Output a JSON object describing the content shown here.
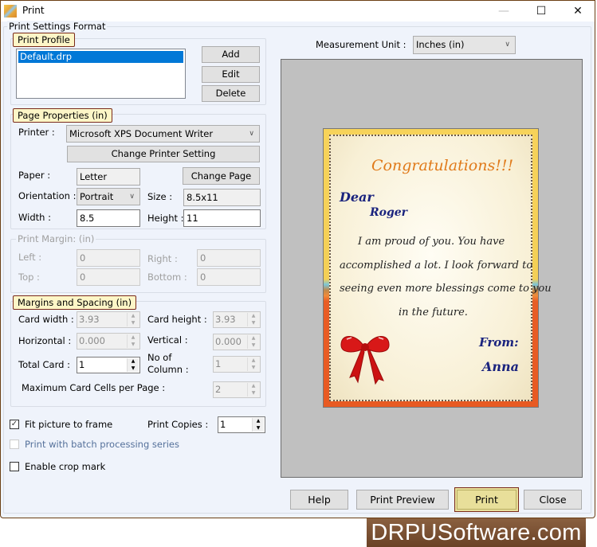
{
  "window": {
    "title": "Print",
    "icon": "print-app-icon",
    "controls": {
      "minimize": "—",
      "maximize": "☐",
      "close": "✕"
    }
  },
  "settings_group": {
    "label": "Print Settings Format"
  },
  "print_profile": {
    "label": "Print Profile",
    "items": [
      "Default.drp"
    ],
    "selected": "Default.drp",
    "buttons": {
      "add": "Add",
      "edit": "Edit",
      "delete": "Delete"
    }
  },
  "page_properties": {
    "label": "Page Properties  (in)",
    "printer_label": "Printer :",
    "printer_value": "Microsoft XPS Document Writer",
    "change_printer_button": "Change Printer Setting",
    "paper_label": "Paper :",
    "paper_value": "Letter",
    "change_page_button": "Change Page",
    "orientation_label": "Orientation :",
    "orientation_value": "Portrait",
    "size_label": "Size :",
    "size_value": "8.5x11",
    "width_label": "Width :",
    "width_value": "8.5",
    "height_label": "Height :",
    "height_value": "11"
  },
  "print_margins": {
    "label": "Print Margin: (in)",
    "left_label": "Left :",
    "left_value": "0",
    "right_label": "Right :",
    "right_value": "0",
    "top_label": "Top :",
    "top_value": "0",
    "bottom_label": "Bottom :",
    "bottom_value": "0"
  },
  "margins_spacing": {
    "label": "Margins and Spacing  (in)",
    "card_width_label": "Card width :",
    "card_width_value": "3.93",
    "card_height_label": "Card height :",
    "card_height_value": "3.93",
    "horizontal_label": "Horizontal :",
    "horizontal_value": "0.000",
    "vertical_label": "Vertical :",
    "vertical_value": "0.000",
    "total_card_label": "Total Card :",
    "total_card_value": "1",
    "no_of_column_label_1": "No of",
    "no_of_column_label_2": "Column :",
    "no_of_column_value": "1",
    "max_cells_label": "Maximum Card Cells per Page :",
    "max_cells_value": "2"
  },
  "options": {
    "fit_picture_label": "Fit picture to frame",
    "fit_picture_checked": true,
    "batch_label": "Print with batch processing series",
    "batch_checked": false,
    "crop_mark_label": "Enable crop mark",
    "crop_mark_checked": false,
    "print_copies_label": "Print Copies :",
    "print_copies_value": "1"
  },
  "measurement": {
    "label": "Measurement Unit :",
    "value": "Inches (in)"
  },
  "card_preview": {
    "heading": "Congratulations!!!",
    "greeting": "Dear",
    "recipient": "Roger",
    "message_lines": [
      "I am proud of you. You have",
      "accomplished a lot. I look forward to",
      "seeing even more blessings come to you",
      "in the future."
    ],
    "from_label": "From:",
    "sender": "Anna",
    "colors": {
      "heading": "#e07a1a",
      "names": "#1a237e",
      "body": "#222222",
      "bow": "#d81818"
    }
  },
  "footer_buttons": {
    "help": "Help",
    "print_preview": "Print Preview",
    "print": "Print",
    "close": "Close"
  },
  "banner": {
    "text": "DRPUSoftware.com"
  }
}
